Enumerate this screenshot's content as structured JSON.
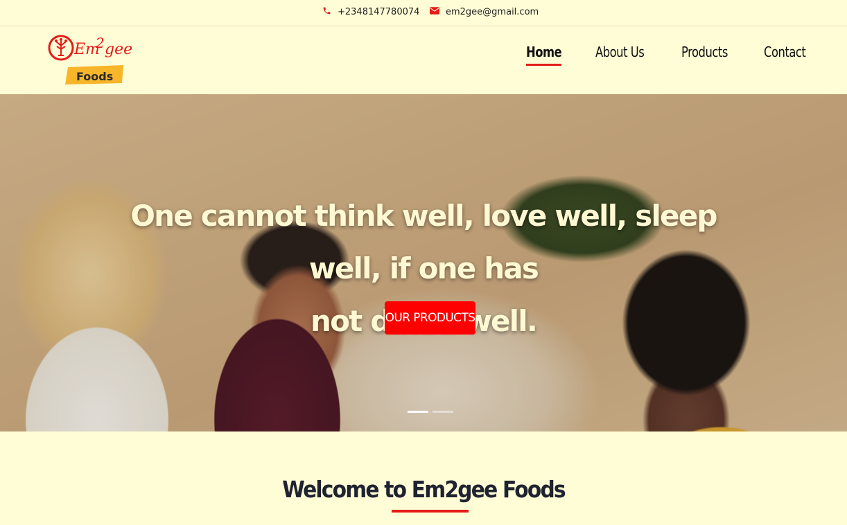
{
  "topbar": {
    "phone": "+2348147780074",
    "email": "em2gee@gmail.com",
    "phone_icon": "phone-icon",
    "email_icon": "envelope-icon"
  },
  "logo": {
    "line1": "Em2gee",
    "line2": "Foods"
  },
  "nav": {
    "home": "Home",
    "about": "About Us",
    "products": "Products",
    "contact": "Contact"
  },
  "hero": {
    "line1": "One cannot think well, love well, sleep well, if one has",
    "line2": "not dined well.",
    "button": "OUR PRODUCTS",
    "slides": 2,
    "active_slide": 1
  },
  "welcome": {
    "title": "Welcome to Em2gee Foods"
  },
  "colors": {
    "background": "#fffdd6",
    "accent": "#e41b17",
    "button": "#ff0000",
    "hero_text": "#fff9d3"
  }
}
